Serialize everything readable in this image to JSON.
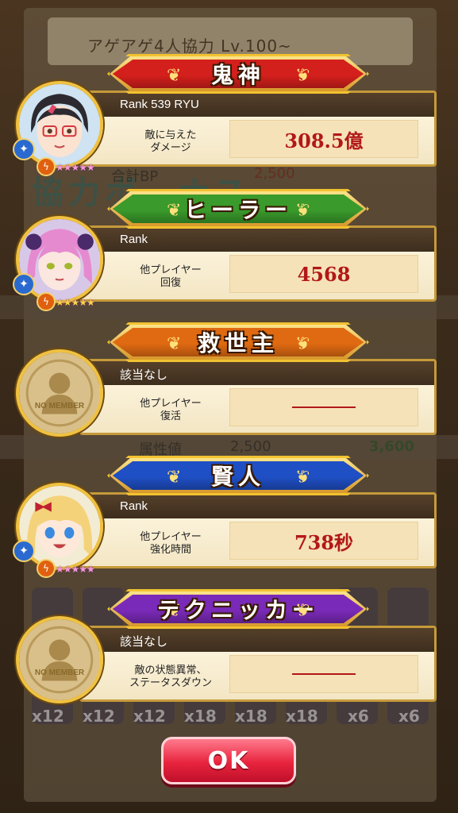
{
  "background": {
    "event_title": "アゲアゲ4人協力 Lv.100~",
    "coop_bonus_text": "協力ボーナス",
    "bp_label": "合計BP",
    "bp_value": "2,500",
    "attr_label": "属性値",
    "attr_from": "2,500",
    "attr_to": "3,600",
    "item_counts": [
      "x12",
      "x12",
      "x12",
      "x18",
      "x18",
      "x18",
      "x6",
      "x6"
    ]
  },
  "entries": [
    {
      "title": "鬼神",
      "banner_color": "#d4201c",
      "rank_text": "Rank  539   RYU",
      "label": "敵に与えた\nダメージ",
      "value": "308.5億",
      "has_player": true,
      "character": "girl-glasses",
      "stars": "★★★★★"
    },
    {
      "title": "ヒーラー",
      "banner_color": "#3a9a2c",
      "rank_text": "Rank",
      "label": "他プレイヤー\n回復",
      "value": "4568",
      "has_player": true,
      "character": "girl-pink-hair",
      "stars": "★★★★★"
    },
    {
      "title": "救世主",
      "banner_color": "#e06a12",
      "rank_text": "該当なし",
      "label": "他プレイヤー\n復活",
      "value": "",
      "has_player": false,
      "no_member_text": "NO MEMBER"
    },
    {
      "title": "賢人",
      "banner_color": "#1f4fc4",
      "rank_text": "Rank",
      "label": "他プレイヤー\n強化時間",
      "value": "738秒",
      "has_player": true,
      "character": "girl-blonde",
      "stars": "★★★★★"
    },
    {
      "title": "テクニッカー",
      "banner_color": "#7a2ab8",
      "rank_text": "該当なし",
      "label": "敵の状態異常、\nステータスダウン",
      "value": "",
      "has_player": false,
      "no_member_text": "NO MEMBER"
    }
  ],
  "ok_button": {
    "label": "OK"
  },
  "icons": [
    "laurel-icon",
    "element-badge-icon",
    "skill-badge-icon",
    "star-icon",
    "silhouette-icon"
  ]
}
